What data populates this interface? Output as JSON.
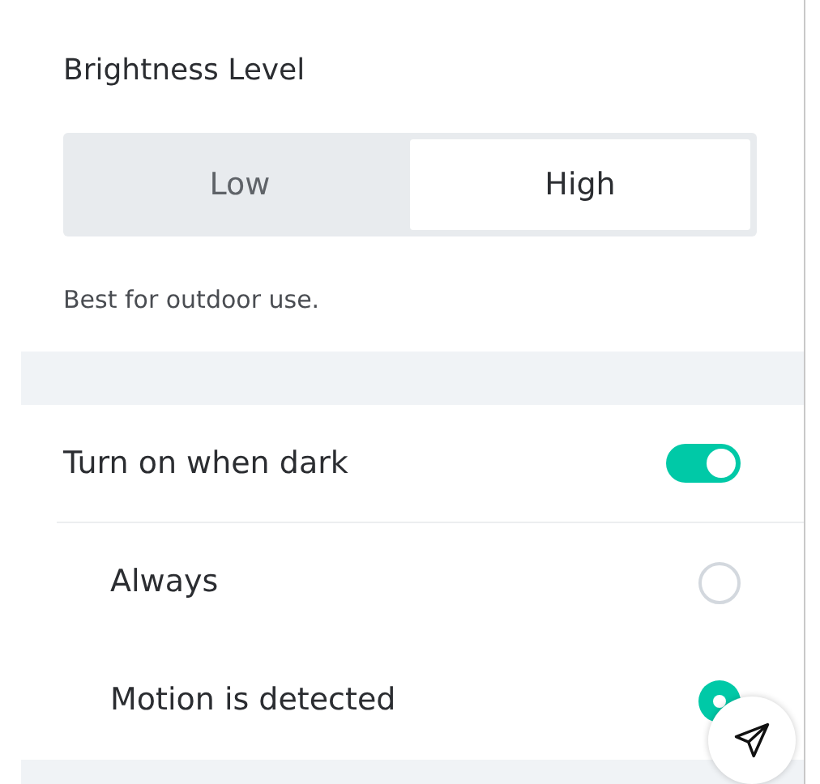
{
  "brightness": {
    "title": "Brightness Level",
    "options": [
      {
        "label": "Low",
        "selected": false
      },
      {
        "label": "High",
        "selected": true
      }
    ],
    "description": "Best for outdoor use."
  },
  "dark_toggle": {
    "label": "Turn on when dark",
    "on": true
  },
  "triggers": [
    {
      "label": "Always",
      "selected": false
    },
    {
      "label": "Motion is detected",
      "selected": true
    }
  ]
}
